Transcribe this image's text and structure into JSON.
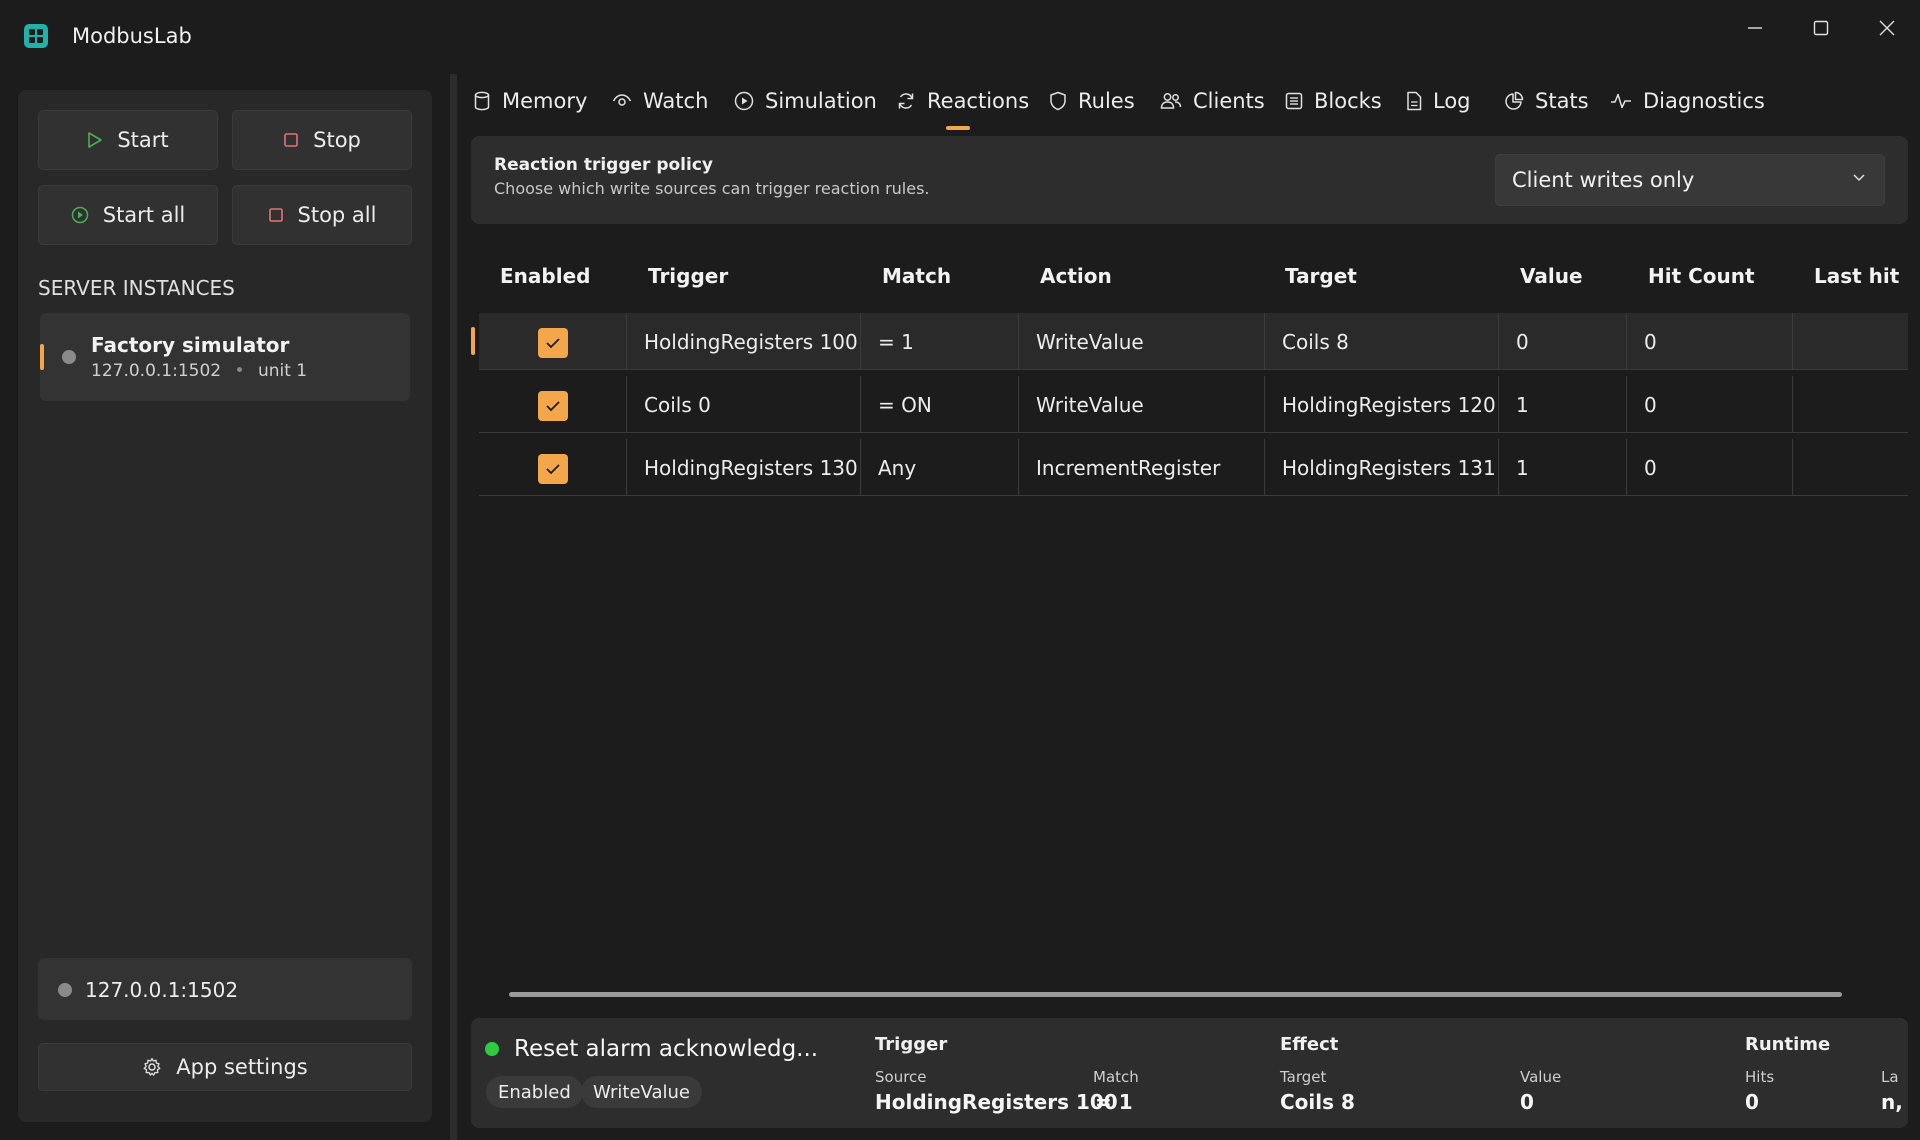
{
  "app": {
    "title": "ModbusLab"
  },
  "sidebar": {
    "buttons": {
      "start": "Start",
      "stop": "Stop",
      "start_all": "Start all",
      "stop_all": "Stop all"
    },
    "instances_heading": "SERVER INSTANCES",
    "instance": {
      "name": "Factory simulator",
      "address": "127.0.0.1:1502",
      "unit": "unit 1"
    },
    "status": "127.0.0.1:1502",
    "settings_label": "App settings"
  },
  "tabs": [
    "Memory",
    "Watch",
    "Simulation",
    "Reactions",
    "Rules",
    "Clients",
    "Blocks",
    "Log",
    "Stats",
    "Diagnostics"
  ],
  "active_tab": "Reactions",
  "policy": {
    "title": "Reaction trigger policy",
    "description": "Choose which write sources can trigger reaction rules.",
    "selected": "Client writes only"
  },
  "table": {
    "headers": [
      "Enabled",
      "Trigger",
      "Match",
      "Action",
      "Target",
      "Value",
      "Hit Count",
      "Last hit"
    ],
    "rows": [
      {
        "enabled": true,
        "trigger": "HoldingRegisters 100",
        "match": "= 1",
        "action": "WriteValue",
        "target": "Coils 8",
        "value": "0",
        "hits": "0",
        "last_hit": ""
      },
      {
        "enabled": true,
        "trigger": "Coils 0",
        "match": "= ON",
        "action": "WriteValue",
        "target": "HoldingRegisters 120",
        "value": "1",
        "hits": "0",
        "last_hit": ""
      },
      {
        "enabled": true,
        "trigger": "HoldingRegisters 130",
        "match": "Any",
        "action": "IncrementRegister",
        "target": "HoldingRegisters 131",
        "value": "1",
        "hits": "0",
        "last_hit": ""
      }
    ]
  },
  "detail": {
    "name": "Reset alarm acknowledg...",
    "chips": [
      "Enabled",
      "WriteValue"
    ],
    "trigger_heading": "Trigger",
    "source_label": "Source",
    "source_value": "HoldingRegisters 100",
    "match_label": "Match",
    "match_value": "= 1",
    "effect_heading": "Effect",
    "target_label": "Target",
    "target_value": "Coils 8",
    "value_label": "Value",
    "value_value": "0",
    "runtime_heading": "Runtime",
    "hits_label": "Hits",
    "hits_value": "0",
    "last_label": "La",
    "last_value": "n,"
  },
  "colors": {
    "accent": "#f3a64a",
    "background": "#1c1c1c",
    "panel": "#282828",
    "success": "#2ecc40",
    "start_icon": "#4caf50",
    "stop_icon": "#e57373",
    "logo": "#20b2aa"
  }
}
